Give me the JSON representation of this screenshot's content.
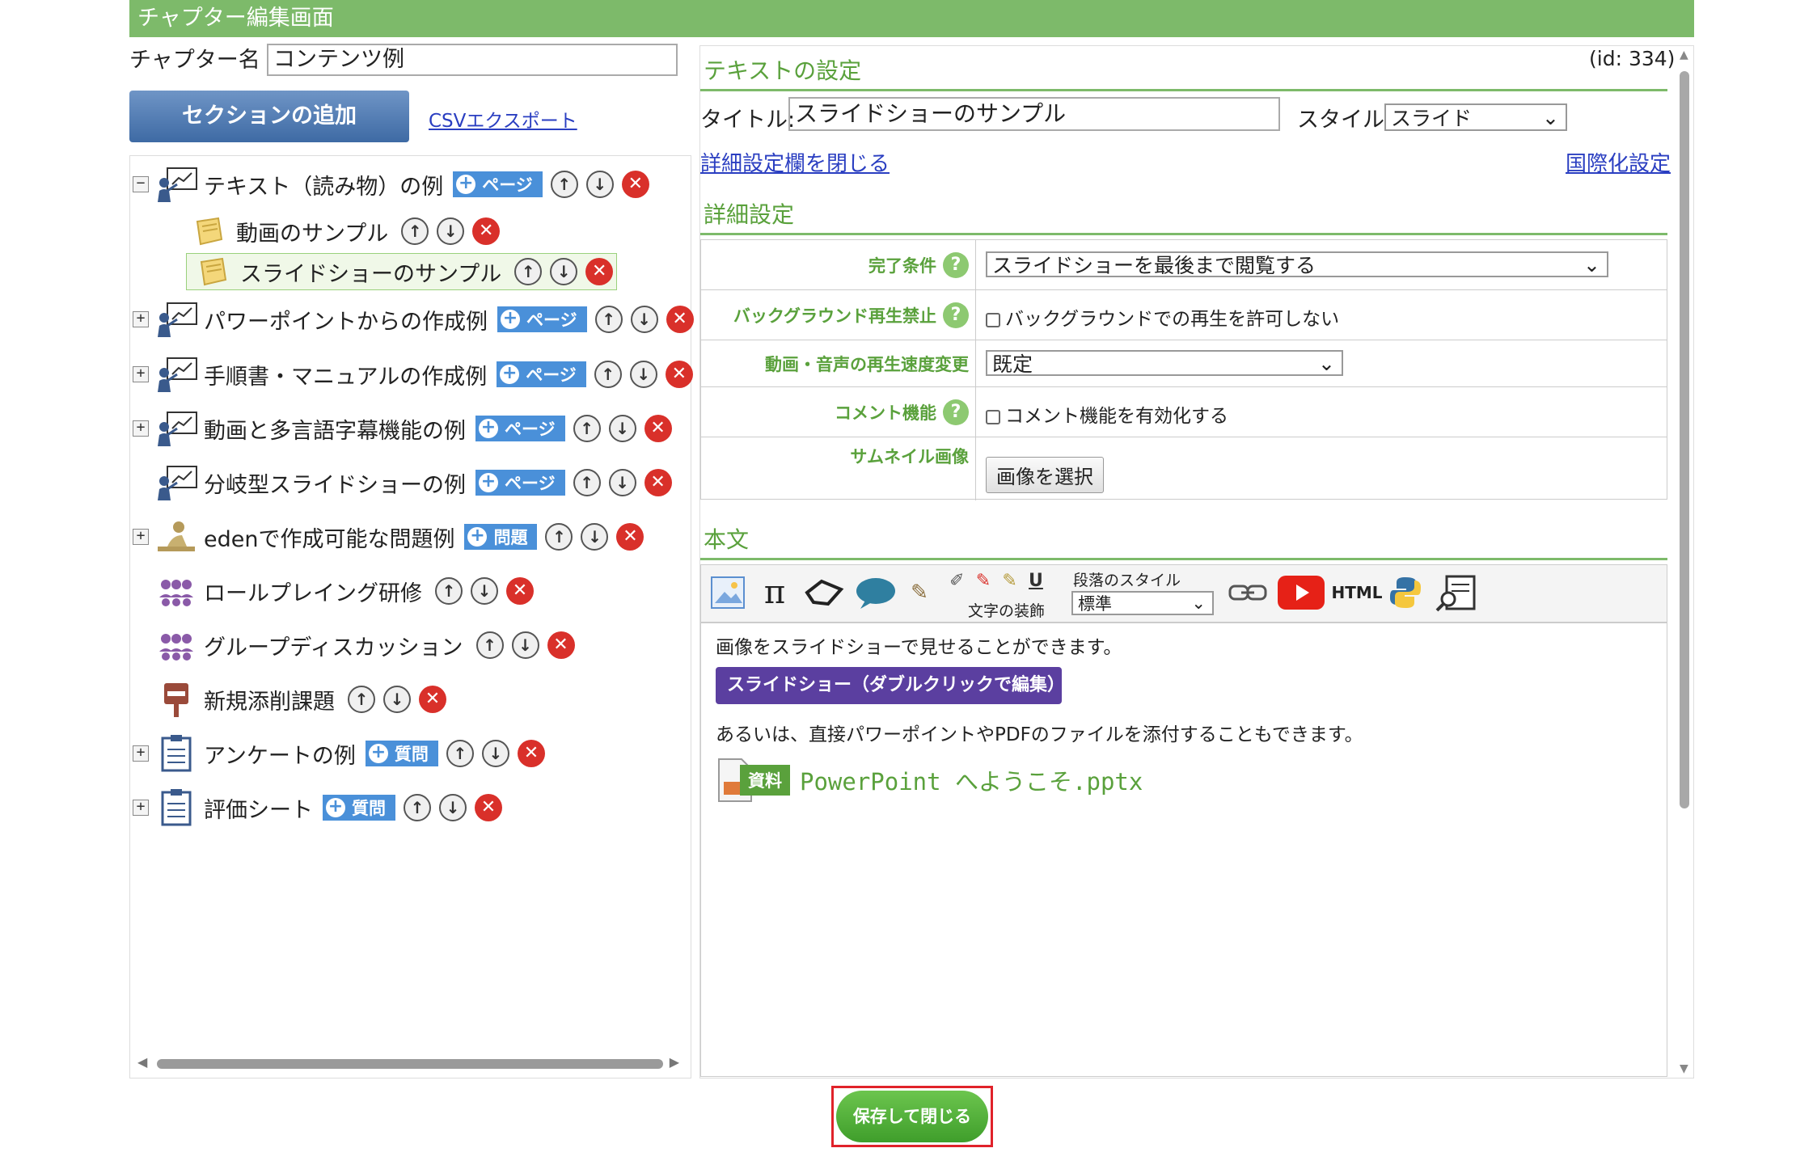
{
  "window": {
    "title": "チャプター編集画面"
  },
  "chapter": {
    "name_label": "チャプター名 :",
    "name_value": "コンテンツ例"
  },
  "actions": {
    "add_section": "セクションの追加",
    "csv_export": "CSVエクスポート",
    "save_close": "保存して閉じる"
  },
  "tree": {
    "items": [
      {
        "label": "テキスト（読み物）の例",
        "badge": "ページ",
        "expander": "−",
        "icon": "presenter-icon"
      },
      {
        "label": "動画のサンプル",
        "icon": "note-icon"
      },
      {
        "label": "スライドショーのサンプル",
        "icon": "note-icon",
        "selected": true
      },
      {
        "label": "パワーポイントからの作成例",
        "badge": "ページ",
        "expander": "+",
        "icon": "presenter-icon"
      },
      {
        "label": "手順書・マニュアルの作成例",
        "badge": "ページ",
        "expander": "+",
        "icon": "presenter-icon"
      },
      {
        "label": "動画と多言語字幕機能の例",
        "badge": "ページ",
        "expander": "+",
        "icon": "presenter-icon"
      },
      {
        "label": "分岐型スライドショーの例",
        "badge": "ページ",
        "icon": "presenter-icon"
      },
      {
        "label": "edenで作成可能な問題例",
        "badge": "問題",
        "expander": "+",
        "icon": "student-icon"
      },
      {
        "label": "ロールプレイング研修",
        "icon": "group-icon"
      },
      {
        "label": "グループディスカッション",
        "icon": "group-icon"
      },
      {
        "label": "新規添削課題",
        "icon": "postbox-icon"
      },
      {
        "label": "アンケートの例",
        "badge": "質問",
        "expander": "+",
        "icon": "clipboard-icon"
      },
      {
        "label": "評価シート",
        "badge": "質問",
        "expander": "+",
        "icon": "clipboard-icon"
      }
    ]
  },
  "panel": {
    "heading": "テキストの設定",
    "id_text": "(id: 334)",
    "title_label": "タイトル:",
    "title_value": "スライドショーのサンプル",
    "style_label": "スタイル:",
    "style_value": "スライド",
    "close_details_link": "詳細設定欄を閉じる",
    "i18n_link": "国際化設定",
    "details_heading": "詳細設定",
    "details": {
      "completion_label": "完了条件",
      "completion_value": "スライドショーを最後まで閲覧する",
      "bg_label": "バックグラウンド再生禁止",
      "bg_value": "バックグラウンドでの再生を許可しない",
      "speed_label": "動画・音声の再生速度変更",
      "speed_value": "既定",
      "comment_label": "コメント機能",
      "comment_value": "コメント機能を有効化する",
      "thumb_label": "サムネイル画像",
      "thumb_button": "画像を選択"
    },
    "body_heading": "本文",
    "toolbar": {
      "decoration_label": "文字の装飾",
      "paragraph_label": "段落のスタイル",
      "paragraph_value": "標準",
      "html_label": "HTML"
    },
    "body": {
      "line1": "画像をスライドショーで見せることができます。",
      "slideshow_button": "スライドショー（ダブルクリックで編集）",
      "line2": "あるいは、直接パワーポイントやPDFのファイルを添付することもできます。",
      "attachment_tag": "資料",
      "attachment_name": "PowerPoint へようこそ.pptx"
    }
  }
}
